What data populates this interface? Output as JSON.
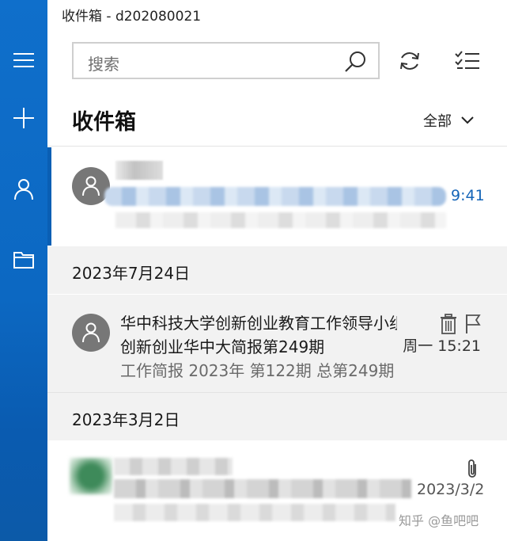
{
  "window": {
    "title": "收件箱 - d202080021"
  },
  "rail": {
    "items": [
      {
        "icon": "hamburger-icon"
      },
      {
        "icon": "plus-icon"
      },
      {
        "icon": "person-icon"
      },
      {
        "icon": "folder-icon"
      }
    ]
  },
  "search": {
    "placeholder": "搜索",
    "icon": "search-icon"
  },
  "toolbar": {
    "sync_icon": "sync-icon",
    "select_icon": "checklist-icon"
  },
  "folder": {
    "title": "收件箱",
    "filter_label": "全部"
  },
  "messages": [
    {
      "time": "9:41",
      "selected": true,
      "sender": "",
      "subject": "",
      "preview": ""
    },
    {
      "group": "2023年7月24日",
      "sender": "华中科技大学创新创业教育工作领导小组办公室",
      "subject": "创新创业华中大简报第249期",
      "preview": "工作简报 2023年 第122期 总第249期",
      "time": "周一 15:21"
    },
    {
      "group": "2023年3月2日",
      "time": "2023/3/2",
      "has_attachment": true
    }
  ],
  "watermark": "知乎 @鱼吧吧",
  "colors": {
    "rail": "#0f6fcb",
    "accent": "#0a5fb4",
    "time_blue": "#1565b8"
  }
}
